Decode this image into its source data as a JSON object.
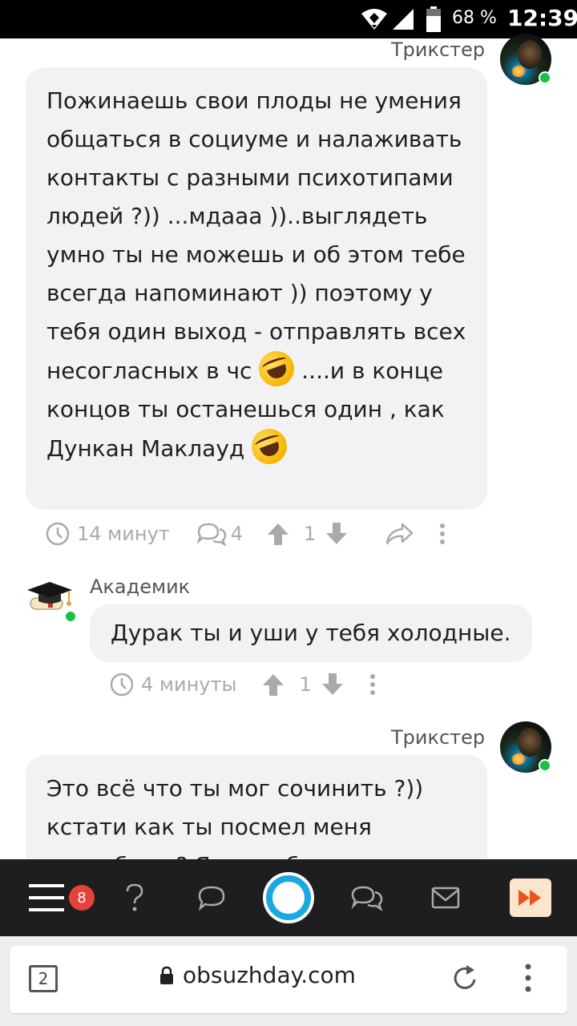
{
  "status_bar": {
    "battery_percent": "68 %",
    "time": "12:39"
  },
  "comments": [
    {
      "author": "Трикстер",
      "text_parts": [
        "Пожинаешь свои плоды не умения общаться в социуме и налаживать контакты с разными психотипами людей ?)) ...мдааа ))..выглядеть умно ты не можешь и об этом тебе всегда напоминают )) поэтому у тебя один выход - отправлять всех несогласных в чс",
        "....и в конце концов ты останешься один , как Дункан Маклауд"
      ],
      "time": "14 минут",
      "replies": "4",
      "score": "1"
    },
    {
      "author": "Академик",
      "text": "Дурак ты и уши у тебя холодные.",
      "time": "4 минуты",
      "score": "1"
    },
    {
      "author": "Трикстер",
      "text": "Это всё что ты мог сочинить ?)) кстати как ты посмел меня оскорбить ? Я же тебя не"
    }
  ],
  "bottom_nav": {
    "notification_count": "8",
    "items": [
      "menu-icon",
      "help-icon",
      "chat-icon",
      "site-logo",
      "discussions-icon",
      "mail-icon",
      "fast-forward-icon"
    ]
  },
  "browser": {
    "tab_count": "2",
    "url": "obsuzhday.com"
  },
  "colors": {
    "bubble": "#f2f2f4",
    "online": "#1bbf45",
    "badge": "#e5423b",
    "logo": "#1aa8e0",
    "meta": "#aaaaaa"
  }
}
